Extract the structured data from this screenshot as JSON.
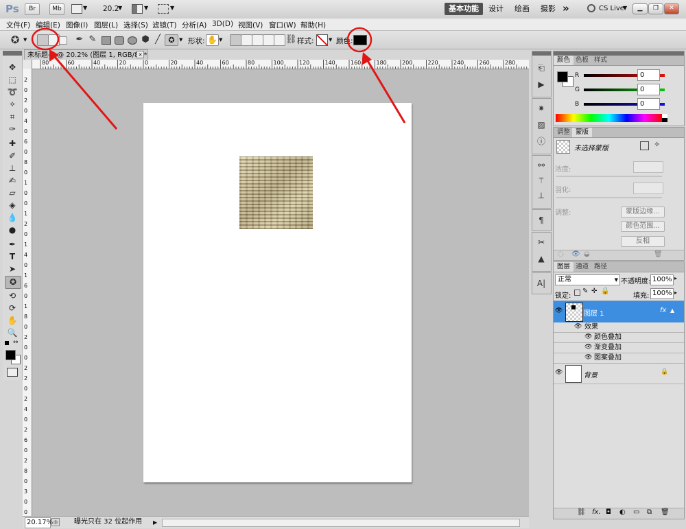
{
  "app": {
    "logo": "Ps",
    "bridge_btn": "Br",
    "minibridge_btn": "Mb",
    "zoom_level": "20.2",
    "workspaces": [
      "基本功能",
      "设计",
      "绘画",
      "摄影"
    ],
    "more": "»",
    "cs_live": "CS Live"
  },
  "menu": [
    "文件(F)",
    "编辑(E)",
    "图像(I)",
    "图层(L)",
    "选择(S)",
    "滤镜(T)",
    "分析(A)",
    "3D(D)",
    "视图(V)",
    "窗口(W)",
    "帮助(H)"
  ],
  "options": {
    "shape_label": "形状:",
    "style_label": "样式:",
    "color_label": "颜色:",
    "color_value": "#000000"
  },
  "document": {
    "tab_title": "未标题-1 @ 20.2% (图层 1, RGB/8) *",
    "close": "×",
    "ruler_top_labels": [
      "80",
      "60",
      "40",
      "20",
      "0",
      "20",
      "40",
      "60",
      "80",
      "100",
      "120",
      "140",
      "160",
      "180",
      "200",
      "220",
      "240",
      "260",
      "280"
    ],
    "ruler_left_labels": [
      "2",
      "0",
      "2",
      "0",
      "4",
      "0",
      "6",
      "0",
      "8",
      "0",
      "1",
      "0",
      "0",
      "1",
      "2",
      "0",
      "1",
      "4",
      "0",
      "1",
      "6",
      "0",
      "1",
      "8",
      "0",
      "2",
      "0",
      "0",
      "2",
      "2",
      "0",
      "2",
      "4",
      "0",
      "2",
      "6",
      "0",
      "2",
      "8",
      "0",
      "3",
      "0",
      "0"
    ]
  },
  "status": {
    "zoom": "20.17%",
    "info": "曝光只在 32 位起作用"
  },
  "color_panel": {
    "tabs": [
      "颜色",
      "色板",
      "样式"
    ],
    "channels": [
      {
        "label": "R",
        "value": "0",
        "color": "#d22020"
      },
      {
        "label": "G",
        "value": "0",
        "color": "#1fa21f"
      },
      {
        "label": "B",
        "value": "0",
        "color": "#2020c8"
      }
    ]
  },
  "masks_panel": {
    "tabs": [
      "调整",
      "蒙版"
    ],
    "title": "未选择蒙版",
    "density_label": "浓度:",
    "feather_label": "羽化:",
    "refine_label": "调整:",
    "btn_edge": "蒙版边缘...",
    "btn_range": "颜色范围...",
    "btn_invert": "反相"
  },
  "layers_panel": {
    "tabs": [
      "图层",
      "通道",
      "路径"
    ],
    "blend_mode": "正常",
    "opacity_label": "不透明度:",
    "opacity": "100%",
    "lock_label": "锁定:",
    "fill_label": "填充:",
    "fill": "100%",
    "layers": [
      {
        "name": "图层 1",
        "fx": "fx"
      },
      {
        "name": "背景"
      }
    ],
    "effects_label": "效果",
    "effects": [
      "颜色叠加",
      "渐变叠加",
      "图案叠加"
    ]
  },
  "accent_color": "#3d8ee0",
  "annotation_color": "#e01616"
}
